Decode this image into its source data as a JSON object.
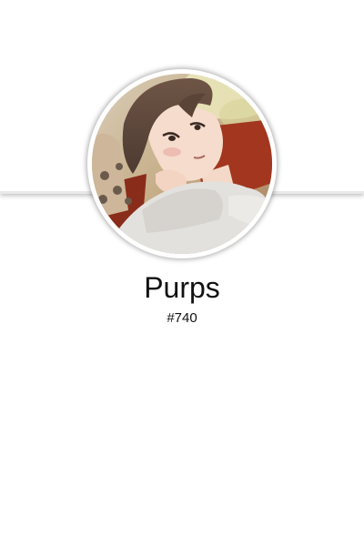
{
  "profile": {
    "name": "Purps",
    "tag": "#740",
    "avatar_icon": "user-avatar"
  }
}
